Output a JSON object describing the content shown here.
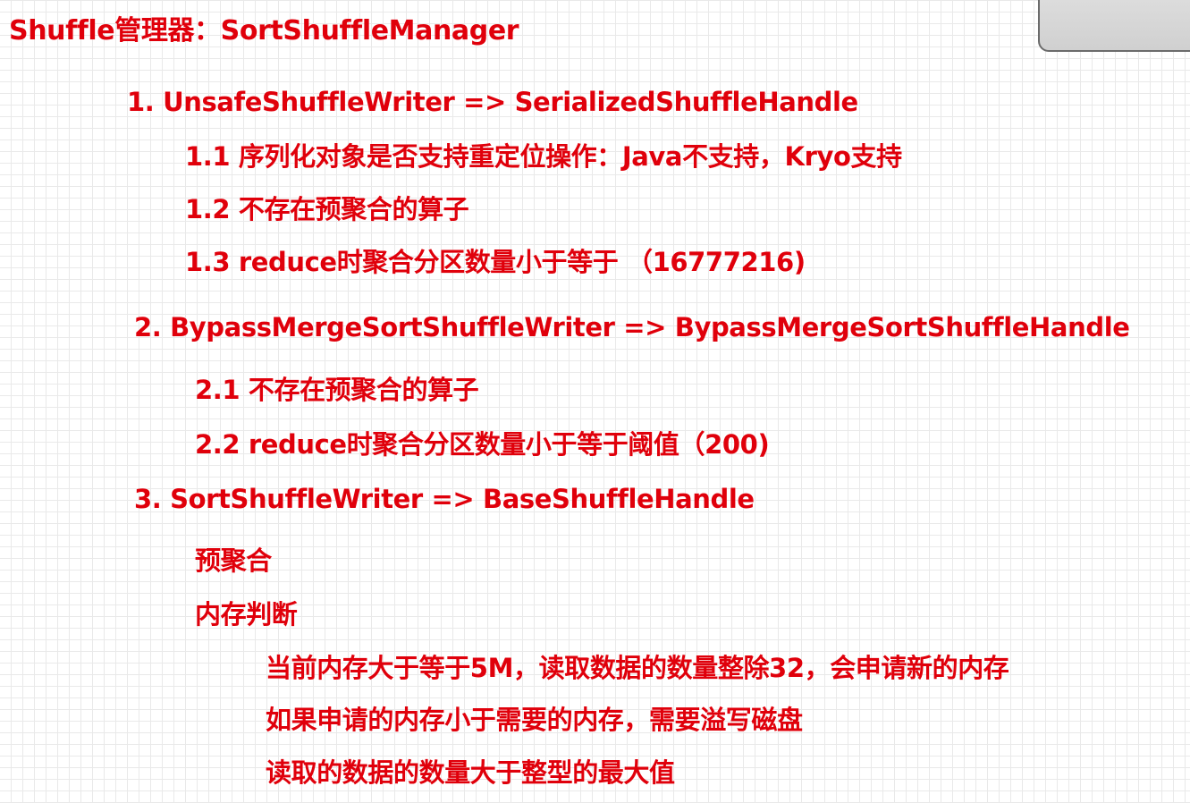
{
  "title": "Shuffle管理器：SortShuffleManager",
  "items": [
    {
      "label": "1. UnsafeShuffleWriter => SerializedShuffleHandle",
      "sub": [
        "1.1 序列化对象是否支持重定位操作：Java不支持，Kryo支持",
        "1.2 不存在预聚合的算子",
        "1.3 reduce时聚合分区数量小于等于 （16777216)"
      ]
    },
    {
      "label": "2. BypassMergeSortShuffleWriter => BypassMergeSortShuffleHandle",
      "sub": [
        "2.1 不存在预聚合的算子",
        "2.2 reduce时聚合分区数量小于等于阈值（200)"
      ]
    },
    {
      "label": "3. SortShuffleWriter => BaseShuffleHandle",
      "sub": [
        "预聚合",
        "内存判断"
      ],
      "detail": [
        "当前内存大于等于5M，读取数据的数量整除32，会申请新的内存",
        "如果申请的内存小于需要的内存，需要溢写磁盘",
        "读取的数据的数量大于整型的最大值"
      ]
    }
  ],
  "colors": {
    "text": "#e0000b",
    "grid": "#e9e9e9",
    "panel": "#d4d4d4"
  }
}
